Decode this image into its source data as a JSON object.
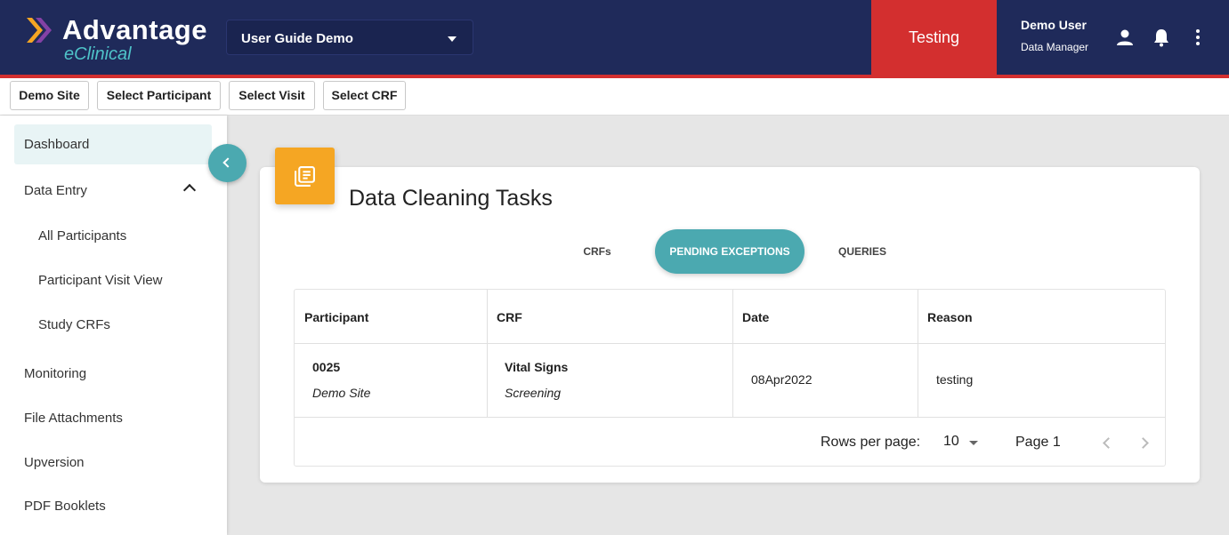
{
  "header": {
    "logo_title": "Advantage",
    "logo_subtitle": "eClinical",
    "study_selector": "User Guide Demo",
    "environment": "Testing",
    "user_name": "Demo User",
    "user_role": "Data Manager",
    "icons": [
      "person-icon",
      "bell-icon",
      "more-vert-icon"
    ],
    "colors": {
      "navy": "#1f2a5a",
      "env_red": "#d32f2f",
      "teal": "#4ba9b0",
      "orange": "#f5a623"
    }
  },
  "crumbs": [
    "Demo Site",
    "Select Participant",
    "Select Visit",
    "Select CRF"
  ],
  "sidebar": {
    "items": [
      {
        "label": "Dashboard"
      },
      {
        "label": "Data Entry"
      },
      {
        "label": "All Participants"
      },
      {
        "label": "Participant Visit View"
      },
      {
        "label": "Study CRFs"
      },
      {
        "label": "Monitoring"
      },
      {
        "label": "File Attachments"
      },
      {
        "label": "Upversion"
      },
      {
        "label": "PDF Booklets"
      }
    ]
  },
  "card": {
    "title": "Data Cleaning Tasks",
    "tabs": [
      "CRFs",
      "PENDING EXCEPTIONS",
      "QUERIES"
    ],
    "active_tab": "PENDING EXCEPTIONS",
    "columns": [
      "Participant",
      "CRF",
      "Date",
      "Reason"
    ],
    "rows": [
      {
        "participant": "0025",
        "site": "Demo Site",
        "crf": "Vital Signs",
        "visit": "Screening",
        "date": "08Apr2022",
        "reason": "testing"
      }
    ],
    "pager": {
      "rows_label": "Rows per page:",
      "rows_value": "10",
      "page_label": "Page 1"
    }
  }
}
